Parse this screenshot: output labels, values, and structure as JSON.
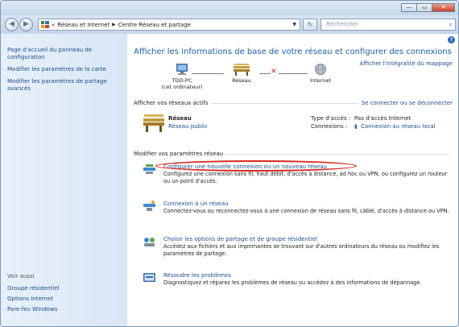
{
  "window": {
    "caption": {
      "minimize": "—",
      "maximize": "▭",
      "close": "✕"
    }
  },
  "nav": {
    "back_glyph": "◀",
    "forward_glyph": "▶",
    "breadcrumb": [
      "Réseau et Internet",
      "Centre Réseau et partage"
    ],
    "crumb_prefix": "«",
    "refresh_glyph": "↻",
    "search_placeholder": "Rechercher",
    "search_glyph": "⌕"
  },
  "sidebar": {
    "links": [
      "Page d'accueil du panneau de configuration",
      "Modifier les paramètres de la carte",
      "Modifier les paramètres de partage avancés"
    ],
    "see_also": "Voir aussi",
    "see_also_links": [
      "Groupe résidentiel",
      "Options Internet",
      "Pare-feu Windows"
    ]
  },
  "main": {
    "title": "Afficher les informations de base de votre réseau et configurer des connexions",
    "map_all": "Afficher l'intégralité du mappage",
    "map": {
      "pc_name": "TDD-PC",
      "pc_sub": "(cet ordinateur)",
      "network": "Réseau",
      "internet": "Internet"
    },
    "active_header": "Afficher vos réseaux actifs",
    "connect_link": "Se connecter ou se déconnecter",
    "active_network": {
      "name": "Réseau",
      "type": "Réseau public",
      "access_label": "Type d'accès :",
      "access_value": "Pas d'accès Internet",
      "connections_label": "Connexions :",
      "connections_value": "Connexion au réseau local"
    },
    "settings_header": "Modifier vos paramètres réseau",
    "tasks": [
      {
        "link": "Configurer une nouvelle connexion ou un nouveau réseau",
        "desc": "Configurez une connexion sans fil, haut débit, d'accès à distance, ad hoc ou VPN, ou configurez un routeur ou un point d'accès."
      },
      {
        "link": "Connexion à un réseau",
        "desc": "Connectez-vous ou reconnectez-vous à une connexion de réseau sans fil, câblé, d'accès à distance ou VPN."
      },
      {
        "link": "Choisir les options de partage et de groupe résidentiel",
        "desc": "Accédez aux fichiers et aux imprimantes se trouvant sur d'autres ordinateurs du réseau ou modifiez les paramètres de partage."
      },
      {
        "link": "Résoudre les problèmes",
        "desc": "Diagnostiquez et réparez les problèmes de réseau ou accédez à des informations de dépannage."
      }
    ],
    "help_glyph": "?"
  }
}
